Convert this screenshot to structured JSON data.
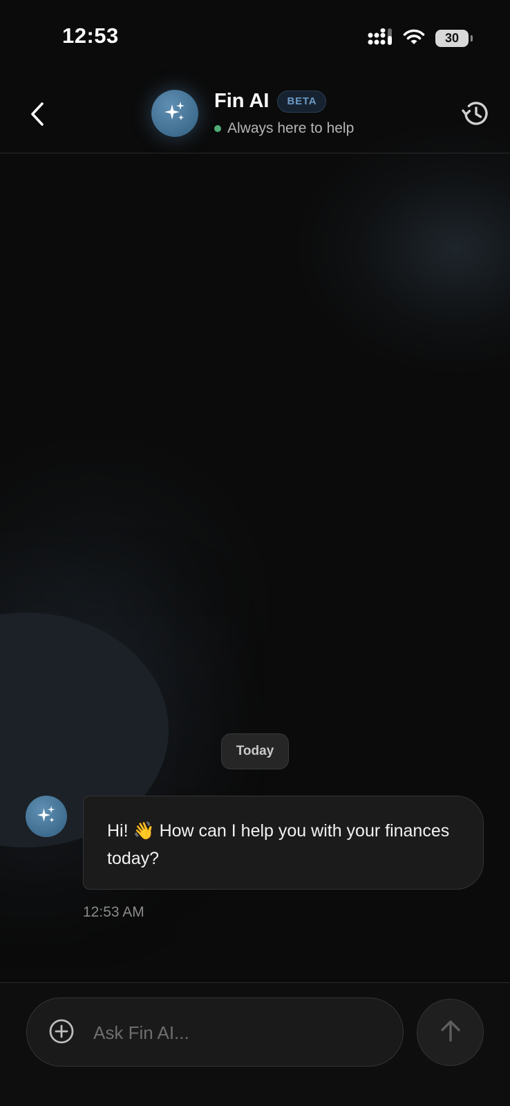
{
  "status_bar": {
    "time": "12:53",
    "battery": "30",
    "signal_icon": "cellular-signal-icon",
    "wifi_icon": "wifi-icon"
  },
  "header": {
    "back_icon": "chevron-left-icon",
    "avatar_icon": "sparkles-icon",
    "title": "Fin AI",
    "badge": "BETA",
    "subtitle": "Always here to help",
    "status_color": "#4fae77",
    "history_icon": "history-icon"
  },
  "chat": {
    "date_divider": "Today",
    "messages": [
      {
        "sender": "assistant",
        "text": "Hi! 👋 How can I help you with your finances today?",
        "time": "12:53 AM"
      }
    ]
  },
  "composer": {
    "attach_icon": "plus-circle-icon",
    "placeholder": "Ask Fin AI...",
    "value": "",
    "send_icon": "arrow-up-icon"
  },
  "colors": {
    "background": "#0b0b0b",
    "accent": "#4a7ea3",
    "badge_text": "#6c9ac4"
  }
}
